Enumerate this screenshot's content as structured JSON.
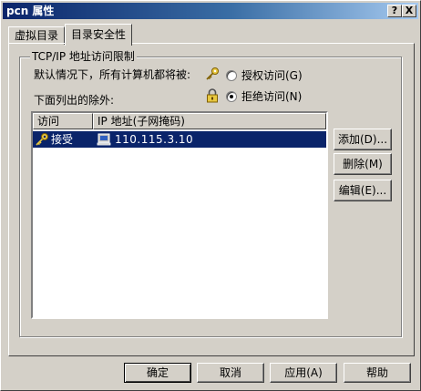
{
  "window": {
    "title": "pcn 属性",
    "help_button": "?",
    "close_button": "X"
  },
  "tabs": [
    {
      "label": "虚拟目录",
      "active": false
    },
    {
      "label": "目录安全性",
      "active": true
    }
  ],
  "ip_restrictions": {
    "group_title": "TCP/IP 地址访问限制",
    "default_text": "默认情况下，所有计算机都将被:",
    "grant_label": "授权访问(G)",
    "deny_label": "拒绝访问(N)",
    "selected": "deny",
    "exceptions_label": "下面列出的除外:",
    "columns": [
      "访问",
      "IP 地址(子网掩码)"
    ],
    "rows": [
      {
        "access": "接受",
        "ip": "110.115.3.10",
        "selected": true
      }
    ],
    "buttons": {
      "add": "添加(D)...",
      "remove": "删除(M)",
      "edit": "编辑(E)..."
    }
  },
  "footer": {
    "ok": "确定",
    "cancel": "取消",
    "apply": "应用(A)",
    "help": "帮助"
  },
  "icons": {
    "key": "key-icon",
    "lock": "lock-icon",
    "computer": "computer-icon"
  },
  "colors": {
    "titlebar_start": "#0a246a",
    "titlebar_end": "#a6caf0",
    "selection": "#0a246a",
    "face": "#d4d0c8"
  }
}
